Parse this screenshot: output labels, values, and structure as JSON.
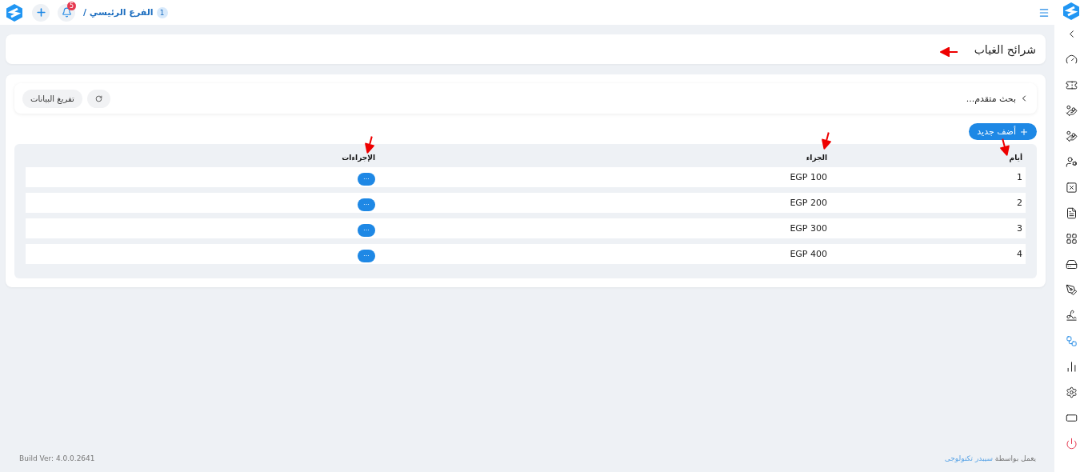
{
  "topbar": {
    "notifications": "5",
    "branch": "الفرع الرئيسي /",
    "branch_count": "1"
  },
  "sidebar": {
    "items": [
      {
        "selected": false
      },
      {
        "selected": false
      },
      {
        "selected": false
      },
      {
        "selected": false
      },
      {
        "selected": false
      },
      {
        "selected": false
      },
      {
        "selected": false
      },
      {
        "selected": false
      },
      {
        "selected": false
      },
      {
        "selected": false
      },
      {
        "selected": false
      },
      {
        "selected": true
      },
      {
        "selected": false
      },
      {
        "selected": false
      },
      {
        "selected": false
      },
      {
        "selected": false
      }
    ]
  },
  "page": {
    "title": "شرائح الغياب"
  },
  "filters": {
    "advanced_search": "بحث متقدم...",
    "clear_button": "تفريغ البيانات"
  },
  "add_button": "أضف جديد",
  "table": {
    "columns": [
      "أيام",
      "الجزاء",
      "الإجراءات"
    ],
    "rows": [
      {
        "days": "1",
        "penalty": "EGP 100",
        "action": "···"
      },
      {
        "days": "2",
        "penalty": "EGP 200",
        "action": "···"
      },
      {
        "days": "3",
        "penalty": "EGP 300",
        "action": "···"
      },
      {
        "days": "4",
        "penalty": "EGP 400",
        "action": "···"
      }
    ]
  },
  "footer": {
    "powered_by": "يعمل بواسطة",
    "company": "سيبدر تكنولوجى",
    "build": "Build Ver: 4.0.0.2641"
  }
}
